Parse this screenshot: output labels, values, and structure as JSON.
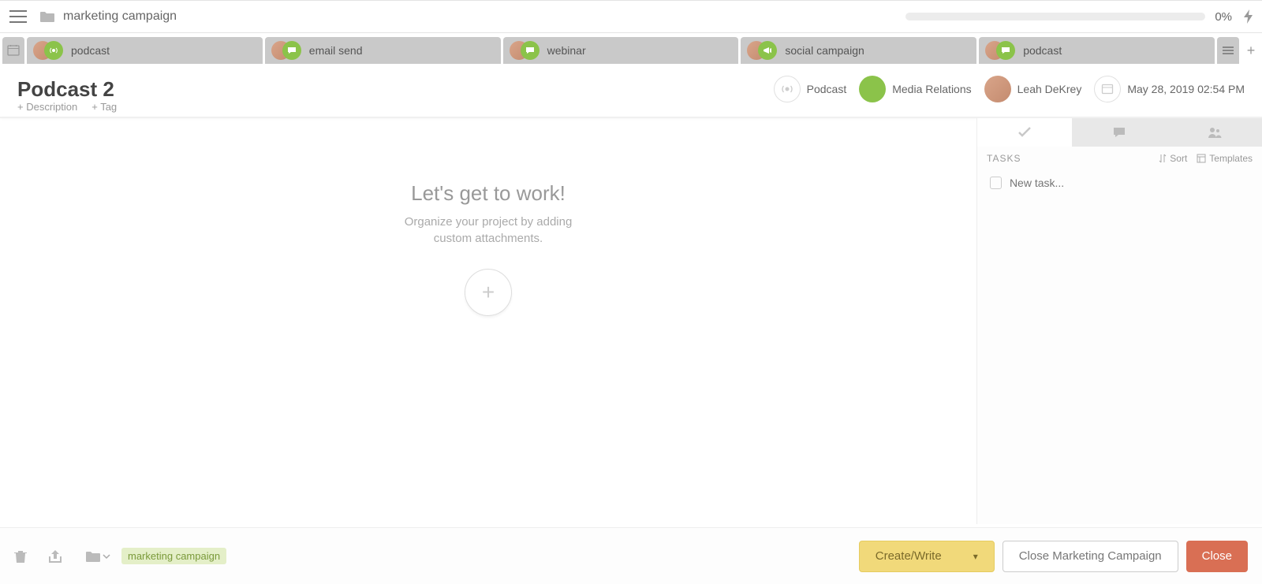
{
  "header": {
    "breadcrumb": "marketing campaign",
    "progress_pct": "0%"
  },
  "tabs": [
    {
      "label": "podcast",
      "icon": "podcast"
    },
    {
      "label": "email send",
      "icon": "chat"
    },
    {
      "label": "webinar",
      "icon": "chat"
    },
    {
      "label": "social campaign",
      "icon": "megaphone"
    },
    {
      "label": "podcast",
      "icon": "chat"
    }
  ],
  "page": {
    "title": "Podcast 2",
    "add_description": "+ Description",
    "add_tag": "+ Tag"
  },
  "meta": {
    "type_label": "Podcast",
    "category_label": "Media Relations",
    "owner_label": "Leah DeKrey",
    "datetime_label": "May 28, 2019 02:54 PM"
  },
  "empty": {
    "title": "Let's get to work!",
    "sub1": "Organize your project by adding",
    "sub2": "custom attachments."
  },
  "sidebar": {
    "heading": "TASKS",
    "sort": "Sort",
    "templates": "Templates",
    "new_task_placeholder": "New task..."
  },
  "footer": {
    "folder_tag": "marketing campaign",
    "create_write": "Create/Write",
    "close_campaign": "Close Marketing Campaign",
    "close": "Close"
  }
}
